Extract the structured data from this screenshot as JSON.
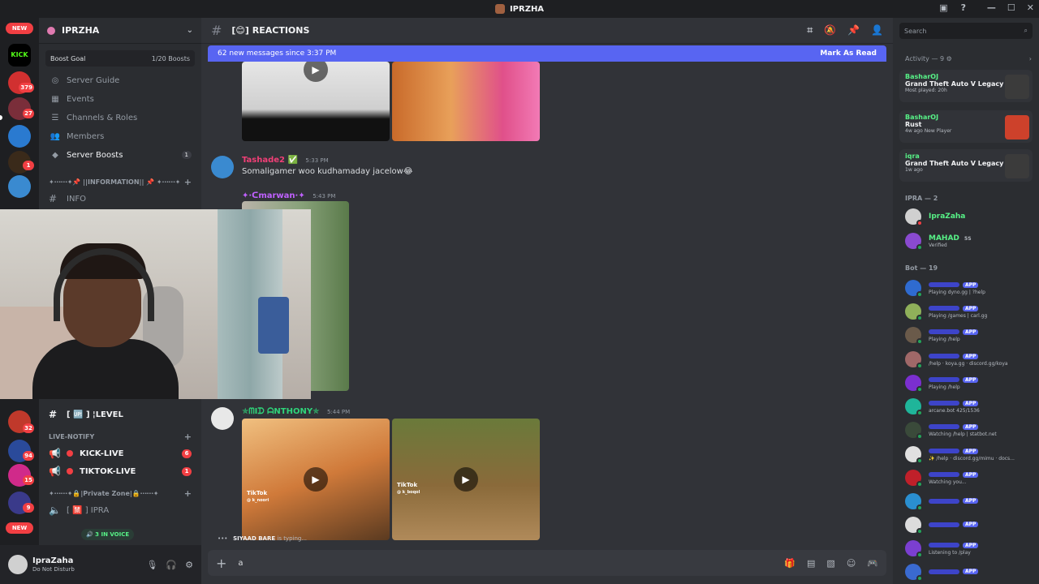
{
  "window": {
    "title": "IPRZHA"
  },
  "server_rail": {
    "new_label_top": "NEW",
    "kick_label": "KICK",
    "badges": [
      "379",
      "27",
      "1"
    ],
    "badges_lower": [
      "32",
      "94",
      "15",
      "9"
    ],
    "new_label_bottom": "NEW"
  },
  "sidebar": {
    "guild_name": "IPRZHA",
    "boost_goal": {
      "label": "Boost Goal",
      "progress": "1/20 Boosts"
    },
    "items": [
      {
        "label": "Server Guide",
        "icon": "compass-icon"
      },
      {
        "label": "Events",
        "icon": "calendar-icon"
      },
      {
        "label": "Channels & Roles",
        "icon": "list-icon"
      },
      {
        "label": "Members",
        "icon": "people-icon"
      },
      {
        "label": "Server Boosts",
        "icon": "boost-icon",
        "count": "1"
      }
    ],
    "info_category": "✦⋯⋯✦📌 ||INFORMATION|| 📌 ✦⋯⋯✦",
    "info_channel": "INFO",
    "level_channel": "[ 🆙 ] ¦LEVEL",
    "live_category": "LIVE-NOTIFY",
    "kick_live": "KICK-LIVE",
    "kick_live_badge": "6",
    "tiktok_live": "TIKTOK-LIVE",
    "tiktok_live_badge": "1",
    "private_category": "✦⋯⋯✦🔒|Private Zone|🔒⋯⋯✦",
    "ipra_channel": "[ 🈲 ] IPRA",
    "voice_pill": "3 IN VOICE"
  },
  "user_panel": {
    "name": "IpraZaha",
    "status": "Do Not Disturb"
  },
  "header": {
    "channel_name": "[😊] REACTIONS",
    "icons": [
      "threads-icon",
      "mute-icon",
      "pin-icon",
      "members-icon"
    ]
  },
  "banner": {
    "text": "62 new messages since 3:37 PM",
    "action": "Mark As Read"
  },
  "messages": [
    {
      "author": "Tashade2 ✅",
      "time": "5:33 PM",
      "text": "Somaligamer woo kudhamaday jacelow😂",
      "author_color": "#f23f77"
    },
    {
      "author": "✦·ᑕmarwan·✦",
      "time": "5:43 PM",
      "text": "",
      "author_color": "#c061ff"
    },
    {
      "author": "✯ᗰIᗪ ᗩNTHONY✯",
      "time": "5:44 PM",
      "text": "",
      "author_color": "#2fd47a"
    }
  ],
  "tiktok_label": "TikTok",
  "tiktok_handles": [
    "@ k_noori",
    "@ k_boqol"
  ],
  "composer": {
    "typing_user": "SIYAAD BARE",
    "typing_suffix": "is typing...",
    "value": "a",
    "icons": [
      "gift-icon",
      "gif-icon",
      "sticker-icon",
      "emoji-icon",
      "controller-icon"
    ]
  },
  "members_panel": {
    "search_placeholder": "Search",
    "activity_header": "Activity — 9",
    "activities": [
      {
        "user": "BasharOJ",
        "game": "Grand Theft Auto V Legacy",
        "meta": "Most played: 20h",
        "thumb_color": "#3b3b3b"
      },
      {
        "user": "BasharOJ",
        "game": "Rust",
        "meta": "4w ago  New Player",
        "thumb_color": "#cd412b"
      },
      {
        "user": "iqra",
        "game": "Grand Theft Auto V Legacy",
        "meta": "1w ago",
        "thumb_color": "#3b3b3b"
      }
    ],
    "group_ipra": "IPRA — 2",
    "ipra_members": [
      {
        "name": "IpraZaha",
        "sub": "",
        "color": "#57f287"
      },
      {
        "name": "MAHAD",
        "sub": "Verified",
        "color": "#57f287",
        "tag": "5S"
      }
    ],
    "group_bot": "Bot — 19",
    "bots": [
      {
        "sub": "Playing dyno.gg | ?help",
        "ava": "#2f6bd0"
      },
      {
        "sub": "Playing /games | carl.gg",
        "ava": "#8fb05a"
      },
      {
        "sub": "Playing /help",
        "ava": "#6a5a4a"
      },
      {
        "sub": "/help · koya.gg · discord.gg/koya",
        "ava": "#a06868"
      },
      {
        "sub": "Playing /help",
        "ava": "#7b2fd0"
      },
      {
        "sub": "arcane.bot 425/1536",
        "ava": "#1fb59a"
      },
      {
        "sub": "Watching /help | statbot.net",
        "ava": "#3a4a3a"
      },
      {
        "sub": "✨ /help · discord.gg/mimu · docs...",
        "ava": "#e0e0e0"
      },
      {
        "sub": "Watching you...",
        "ava": "#c0202a"
      },
      {
        "sub": "",
        "ava": "#2a8fd0"
      },
      {
        "sub": "",
        "ava": "#dcdcdc"
      },
      {
        "sub": "Listening to /play",
        "ava": "#7b3fd0"
      },
      {
        "sub": "",
        "ava": "#3a6ad0"
      }
    ],
    "app_tag": "APP"
  }
}
